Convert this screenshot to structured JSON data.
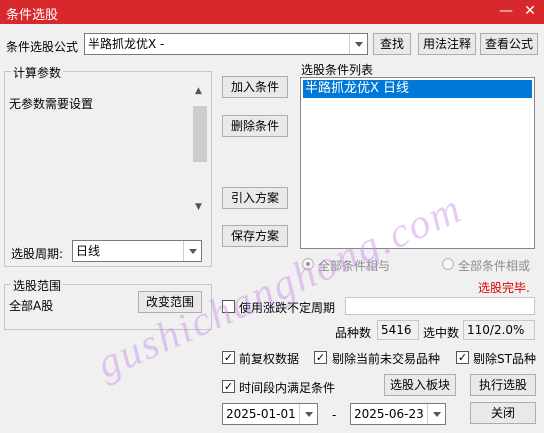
{
  "window": {
    "title": "条件选股",
    "minimize": "—",
    "close": "✕"
  },
  "top": {
    "formula_label": "条件选股公式",
    "formula_value": "半路抓龙优X  -",
    "find_btn": "查找",
    "usage_btn": "用法注释",
    "view_btn": "查看公式"
  },
  "params": {
    "legend": "计算参数",
    "none_text": "无参数需要设置",
    "period_label": "选股周期:",
    "period_value": "日线"
  },
  "middle_buttons": {
    "add": "加入条件",
    "delete": "删除条件",
    "import": "引入方案",
    "save": "保存方案"
  },
  "condition_list": {
    "label": "选股条件列表",
    "items": [
      "半路抓龙优X  日线"
    ],
    "radio_and": "全部条件相与",
    "radio_or": "全部条件相或"
  },
  "status": {
    "text": "选股完毕.",
    "color": "#e00000"
  },
  "range": {
    "legend": "选股范围",
    "value": "全部A股",
    "change_btn": "改变范围"
  },
  "options": {
    "uncertain_period": "使用涨跌不定周期",
    "count_label": "品种数",
    "count_value": "5416",
    "selected_label": "选中数",
    "selected_value": "110/2.0%",
    "adjust": "前复权数据",
    "exclude_untraded": "剔除当前未交易品种",
    "exclude_st": "剔除ST品种",
    "time_range": "时间段内满足条件"
  },
  "actions": {
    "to_sector": "选股入板块",
    "execute": "执行选股",
    "close": "关闭"
  },
  "dates": {
    "start": "2025-01-01",
    "dash": "-",
    "end": "2025-06-23"
  },
  "watermark": "gushichanghong.com",
  "colors": {
    "titlebar": "#d9282c",
    "selection": "#0078d7"
  }
}
